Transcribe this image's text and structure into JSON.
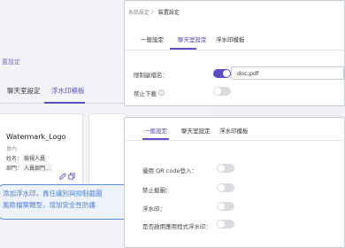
{
  "back": {
    "breadcrumb": "置設定",
    "tabs": [
      {
        "label": "聊天室設定"
      },
      {
        "label": "浮水印模板"
      }
    ],
    "card": {
      "title": "Watermark_Logo",
      "subtitle": "員內",
      "lines": [
        {
          "label": "姓名：",
          "value": "檢視人員"
        },
        {
          "label": "部門：",
          "value": "人員部門…"
        }
      ]
    },
    "tooltip": {
      "line1": "添加浮水印，責任識別與抑制截圖",
      "line2": "風險檔案類型，增加安全性防護"
    }
  },
  "top": {
    "breadcrumb_parent": "系統設定",
    "breadcrumb_sep": "〉",
    "breadcrumb_current": "裝置設定",
    "tabs": [
      {
        "label": "一般設定"
      },
      {
        "label": "聊天室設定"
      },
      {
        "label": "浮水印模板"
      }
    ],
    "rows": [
      {
        "label": "限制副檔名：",
        "toggle": "on",
        "input_value": "doc;pdf"
      },
      {
        "label": "禁止下載",
        "toggle": "off"
      }
    ]
  },
  "bottom": {
    "tabs": [
      {
        "label": "一般設定"
      },
      {
        "label": "聊天室設定"
      },
      {
        "label": "浮水印模板"
      }
    ],
    "rows": [
      {
        "label": "優用 QR code登入：",
        "toggle": "off"
      },
      {
        "label": "禁止截圖：",
        "toggle": "off"
      },
      {
        "label": "浮水印：",
        "toggle": "off"
      },
      {
        "label": "是否啟用應用程式浮水印：",
        "toggle": "off"
      }
    ]
  },
  "icons": {
    "help": "question-circle-icon",
    "edit": "pencil-icon",
    "copy": "copy-icon"
  },
  "colors": {
    "accent": "#5a4fc4",
    "tooltip_border": "#5b8ee6",
    "tooltip_text": "#4d7fd6"
  }
}
